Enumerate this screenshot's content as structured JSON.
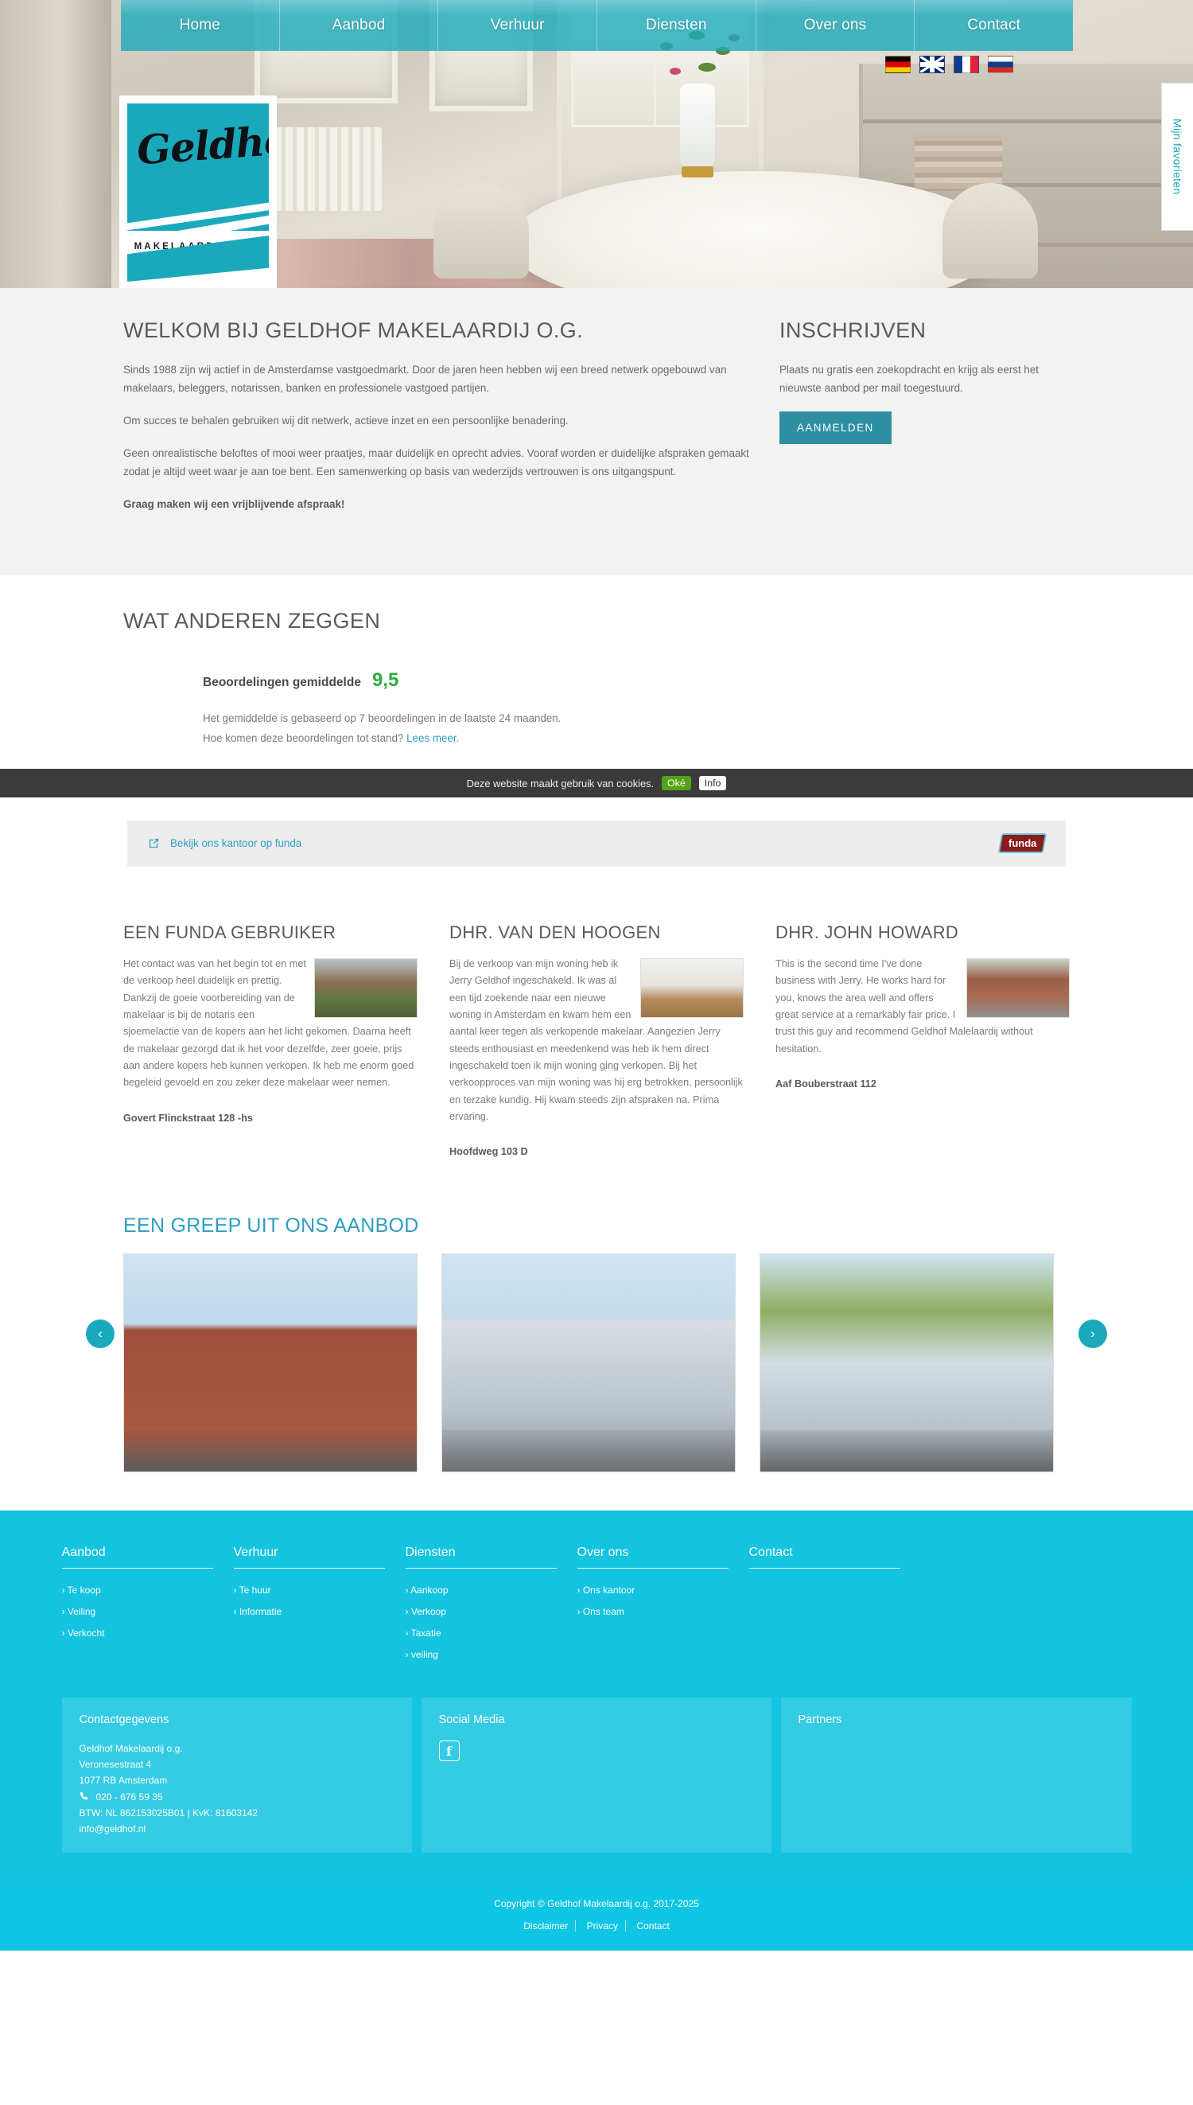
{
  "nav": {
    "items": [
      {
        "label": "Home"
      },
      {
        "label": "Aanbod"
      },
      {
        "label": "Verhuur"
      },
      {
        "label": "Diensten"
      },
      {
        "label": "Over ons"
      },
      {
        "label": "Contact"
      }
    ]
  },
  "languages": [
    {
      "name": "german-flag",
      "code": "de"
    },
    {
      "name": "uk-flag",
      "code": "gb"
    },
    {
      "name": "french-flag",
      "code": "fr"
    },
    {
      "name": "russian-flag",
      "code": "ru"
    }
  ],
  "logo": {
    "word": "Geldhof",
    "subtitle": "MAKELAARDIJ O.G."
  },
  "favorites_tab": {
    "label": "Mijn favorieten"
  },
  "welcome": {
    "title": "WELKOM BIJ GELDHOF MAKELAARDIJ O.G.",
    "p1": "Sinds 1988 zijn wij actief in de Amsterdamse vastgoedmarkt. Door de jaren heen hebben wij een breed netwerk opgebouwd van makelaars, beleggers, notarissen, banken en professionele vastgoed partijen.",
    "p2": "Om succes te behalen gebruiken wij dit netwerk, actieve inzet en een persoonlijke benadering.",
    "p3": "Geen onrealistische beloftes of mooi weer praatjes, maar duidelijk en oprecht advies. Vooraf worden er duidelijke afspraken gemaakt zodat je altijd weet waar je aan toe bent. Een samenwerking op basis van wederzijds vertrouwen is ons uitgangspunt.",
    "p4": "Graag maken wij een vrijblijvende afspraak!"
  },
  "signup": {
    "title": "INSCHRIJVEN",
    "text": "Plaats nu gratis een zoekopdracht en krijg als eerst het nieuwste aanbod per mail toegestuurd.",
    "button": "AANMELDEN"
  },
  "reviews": {
    "title": "WAT ANDEREN ZEGGEN",
    "rating_label": "Beoordelingen gemiddelde",
    "rating_value": "9,5",
    "rating_color": "#2eab43",
    "note_line1": "Het gemiddelde is gebaseerd op 7 beoordelingen in de laatste 24 maanden.",
    "note_line2": "Hoe komen deze beoordelingen tot stand?",
    "note_link": "Lees meer."
  },
  "cookie": {
    "text": "Deze website maakt gebruik van cookies.",
    "ok_label": "Oké",
    "info_label": "Info"
  },
  "funda": {
    "link_text": "Bekijk ons kantoor op funda",
    "logo_text": "funda"
  },
  "testimonials": [
    {
      "name": "EEN FUNDA GEBRUIKER",
      "text": "Het contact was van het begin tot en met de verkoop heel duidelijk en prettig. Dankzij de goeie voorbereiding van de makelaar is bij de notaris een sjoemelactie van de kopers aan het licht gekomen. Daarna heeft de makelaar gezorgd dat ik het voor dezelfde, zeer goeie, prijs aan andere kopers heb kunnen verkopen. Ik heb me enorm goed begeleid gevoeld en zou zeker deze makelaar weer nemen.",
      "address": "Govert Flinckstraat 128 -hs"
    },
    {
      "name": "DHR. VAN DEN HOOGEN",
      "text": "Bij de verkoop van mijn woning heb ik Jerry Geldhof ingeschakeld. Ik was al een tijd zoekende naar een nieuwe woning in Amsterdam en kwam hem een aantal keer tegen als verkopende makelaar. Aangezien Jerry steeds enthousiast en meedenkend was heb ik hem direct ingeschakeld toen ik mijn woning ging verkopen. Bij het verkoopproces van mijn woning was hij erg betrokken, persoonlijk en terzake kundig. Hij kwam steeds zijn afspraken na. Prima ervaring.",
      "address": "Hoofdweg 103 D"
    },
    {
      "name": "DHR. JOHN HOWARD",
      "text": "This is the second time I've done business with Jerry. He works hard for you, knows the area well and offers great service at a remarkably fair price. I trust this guy and recommend Geldhof Malelaardij without hesitation.",
      "address": "Aaf Bouberstraat 112"
    }
  ],
  "carousel": {
    "title": "EEN GREEP UIT ONS AANBOD",
    "prev_icon": "chevron-left-icon",
    "next_icon": "chevron-right-icon",
    "slides": [
      {
        "alt": "Rood bakstenen appartementencomplex"
      },
      {
        "alt": "Modern wit appartementengebouw"
      },
      {
        "alt": "Glazen gebouw met bomen"
      }
    ]
  },
  "footer": {
    "columns": [
      {
        "title": "Aanbod",
        "links": [
          "Te koop",
          "Veiling",
          "Verkocht"
        ]
      },
      {
        "title": "Verhuur",
        "links": [
          "Te huur",
          "Informatie"
        ]
      },
      {
        "title": "Diensten",
        "links": [
          "Aankoop",
          "Verkoop",
          "Taxatie",
          "veiling"
        ]
      },
      {
        "title": "Over ons",
        "links": [
          "Ons kantoor",
          "Ons team"
        ]
      },
      {
        "title": "Contact",
        "links": []
      }
    ],
    "contact_panel": {
      "title": "Contactgegevens",
      "company": "Geldhof Makelaardij o.g.",
      "street": "Veronesestraat 4",
      "city": "1077 RB Amsterdam",
      "phone": "020 - 676 59 35",
      "registration": "BTW: NL 862153025B01 | KvK: 81603142",
      "email": "info@geldhof.nl"
    },
    "social_panel": {
      "title": "Social Media",
      "facebook_icon": "facebook-icon",
      "facebook_glyph": "f"
    },
    "partners_panel": {
      "title": "Partners"
    },
    "copyright": "Copyright © Geldhof Makelaardij o.g. 2017-2025",
    "bottom_links": [
      "Disclaimer",
      "Privacy",
      "Contact"
    ]
  },
  "theme": {
    "accent": "#1aa9bb",
    "footer_bg": "#13c3e0",
    "button_bg": "#2e8fa3"
  }
}
